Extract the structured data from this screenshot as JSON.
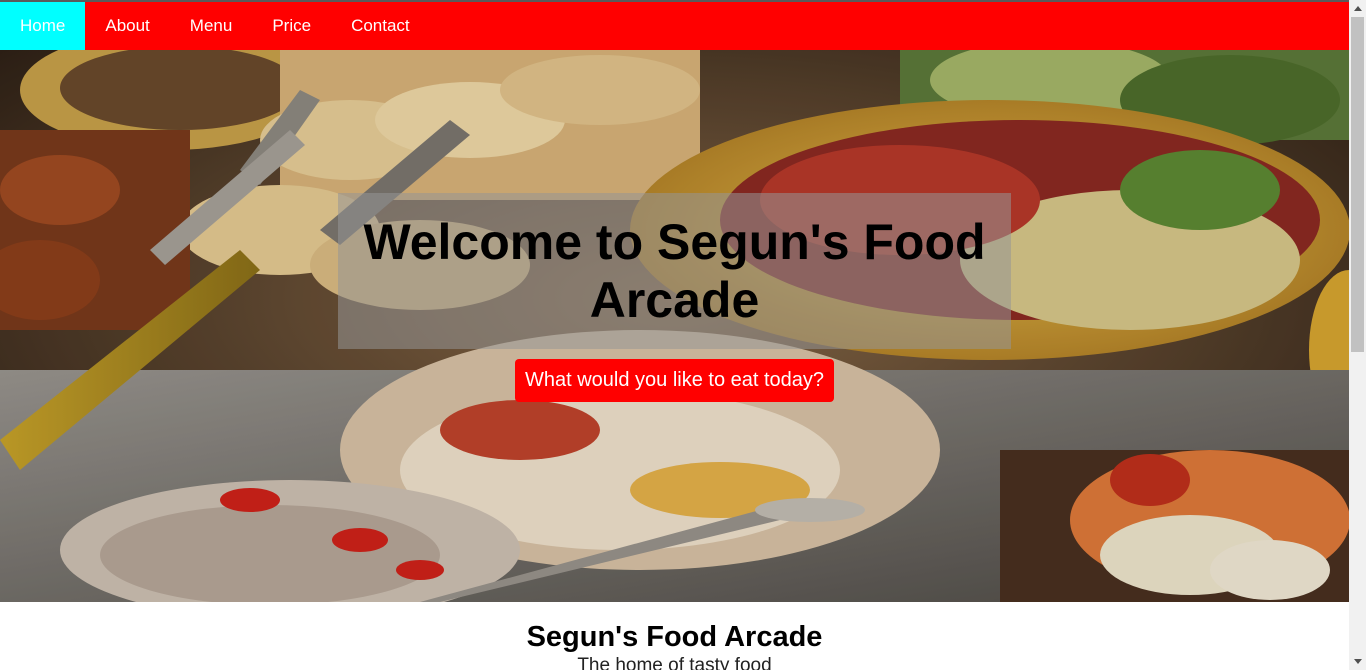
{
  "nav": {
    "items": [
      {
        "label": "Home",
        "active": true
      },
      {
        "label": "About",
        "active": false
      },
      {
        "label": "Menu",
        "active": false
      },
      {
        "label": "Price",
        "active": false
      },
      {
        "label": "Contact",
        "active": false
      }
    ]
  },
  "hero": {
    "title": "Welcome to Segun's Food Arcade",
    "cta_label": "What would you like to eat today?"
  },
  "intro": {
    "heading": "Segun's Food Arcade",
    "tagline": "The home of tasty food"
  },
  "colors": {
    "nav_bg": "#ff0000",
    "nav_active": "#00ffff",
    "cta_bg": "#ff0000"
  }
}
